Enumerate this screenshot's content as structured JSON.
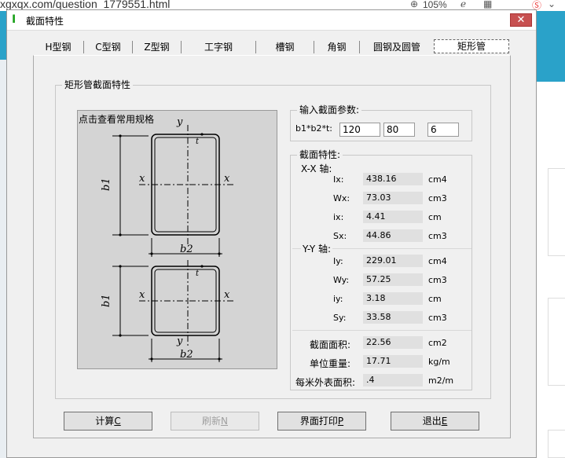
{
  "browser": {
    "url": "xgxqx.com/question_1779551.html",
    "zoom": "105%"
  },
  "window": {
    "title": "截面特性",
    "close_symbol": "✕"
  },
  "tabs": [
    {
      "label": "H型钢"
    },
    {
      "label": "C型钢"
    },
    {
      "label": "Z型钢"
    },
    {
      "label": "工字钢"
    },
    {
      "label": "槽钢"
    },
    {
      "label": "角钢"
    },
    {
      "label": "圆钢及圆管"
    },
    {
      "label": "矩形管",
      "active": true
    }
  ],
  "group_title": "矩形管截面特性",
  "diagram": {
    "hint": "点击查看常用规格",
    "labels": {
      "y": "y",
      "x": "x",
      "t": "t",
      "b1": "b1",
      "b2": "b2"
    }
  },
  "input_group": {
    "title": "输入截面参数:",
    "label": "b1*b2*t:",
    "b1": "120",
    "b2": "80",
    "t": "6"
  },
  "props": {
    "title": "截面特性:",
    "xx_title": "X-X 轴:",
    "yy_title": "Y-Y 轴:",
    "xx": [
      {
        "label": "Ix:",
        "value": "438.16",
        "unit": "cm4"
      },
      {
        "label": "Wx:",
        "value": "73.03",
        "unit": "cm3"
      },
      {
        "label": "ix:",
        "value": "4.41",
        "unit": "cm"
      },
      {
        "label": "Sx:",
        "value": "44.86",
        "unit": "cm3"
      }
    ],
    "yy": [
      {
        "label": "Iy:",
        "value": "229.01",
        "unit": "cm4"
      },
      {
        "label": "Wy:",
        "value": "57.25",
        "unit": "cm3"
      },
      {
        "label": "iy:",
        "value": "3.18",
        "unit": "cm"
      },
      {
        "label": "Sy:",
        "value": "33.58",
        "unit": "cm3"
      }
    ],
    "other": [
      {
        "label": "截面面积:",
        "value": "22.56",
        "unit": "cm2"
      },
      {
        "label": "单位重量:",
        "value": "17.71",
        "unit": "kg/m"
      },
      {
        "label": "每米外表面积:",
        "value": ".4",
        "unit": "m2/m"
      }
    ]
  },
  "buttons": {
    "calc": {
      "label": "计算",
      "key": "C"
    },
    "refresh": {
      "label": "刷新",
      "key": "N"
    },
    "print": {
      "label": "界面打印",
      "key": "P"
    },
    "exit": {
      "label": "退出",
      "key": "E"
    }
  },
  "colors": {
    "close_red": "#c75050",
    "app_icon_green": "#18a018",
    "bg_teal": "#2aa2c9"
  }
}
